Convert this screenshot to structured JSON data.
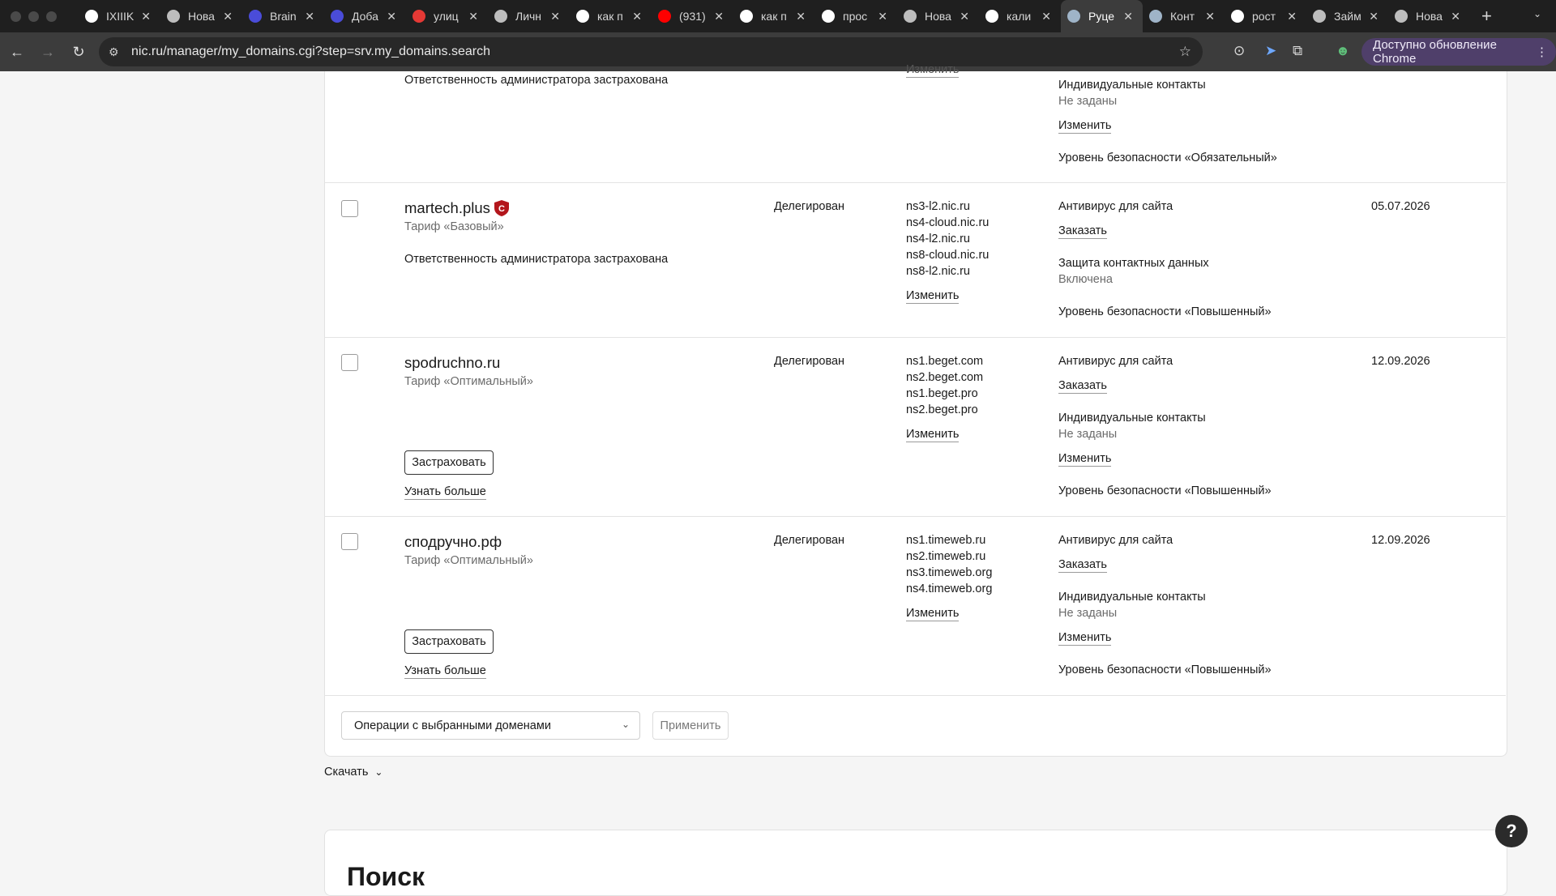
{
  "browser": {
    "tabs": [
      {
        "title": "IXIIIK",
        "icon": "github-icon",
        "color": "#ffffff"
      },
      {
        "title": "Нова",
        "icon": "globe-icon",
        "color": "#bdbdbd"
      },
      {
        "title": "Brain",
        "icon": "brain-app-icon",
        "color": "#4a4cd9"
      },
      {
        "title": "Доба",
        "icon": "brain-app-icon",
        "color": "#4a4cd9"
      },
      {
        "title": "улиц",
        "icon": "maps-pin-icon",
        "color": "#e53935"
      },
      {
        "title": "Личн",
        "icon": "gear-site-icon",
        "color": "#bdbdbd"
      },
      {
        "title": "как п",
        "icon": "google-icon",
        "color": "#ffffff"
      },
      {
        "title": "(931)",
        "icon": "youtube-icon",
        "color": "#ff0000"
      },
      {
        "title": "как п",
        "icon": "google-icon",
        "color": "#ffffff"
      },
      {
        "title": "прос",
        "icon": "google-icon",
        "color": "#ffffff"
      },
      {
        "title": "Нова",
        "icon": "chatgpt-icon",
        "color": "#bdbdbd"
      },
      {
        "title": "кали",
        "icon": "google-icon",
        "color": "#ffffff"
      },
      {
        "title": "Руце",
        "icon": "nic-icon",
        "color": "#9fb4c8"
      },
      {
        "title": "Конт",
        "icon": "nic-icon",
        "color": "#9fb4c8"
      },
      {
        "title": "рост",
        "icon": "google-icon",
        "color": "#ffffff"
      },
      {
        "title": "Займ",
        "icon": "globe-icon",
        "color": "#bdbdbd"
      },
      {
        "title": "Нова",
        "icon": "loading-icon",
        "color": "#bdbdbd"
      }
    ],
    "active_tab_index": 12,
    "url": "nic.ru/manager/my_domains.cgi?step=srv.my_domains.search",
    "update_button": "Доступно обновление Chrome"
  },
  "top_partial": {
    "ns_change": "Изменить",
    "insurance": "Ответственность администратора застрахована",
    "contacts_label": "Индивидуальные контакты",
    "contacts_value": "Не заданы",
    "contacts_change": "Изменить",
    "security": "Уровень безопасности «Обязательный»"
  },
  "domains": [
    {
      "name": "martech.plus",
      "tariff": "Тариф «Базовый»",
      "insurance": "Ответственность администратора застрахована",
      "status": "Делегирован",
      "ns": [
        "ns3-l2.nic.ru",
        "ns4-cloud.nic.ru",
        "ns4-l2.nic.ru",
        "ns8-cloud.nic.ru",
        "ns8-l2.nic.ru"
      ],
      "ns_change": "Изменить",
      "antivirus": "Антивирус для сайта",
      "antivirus_action": "Заказать",
      "contacts_label": "Защита контактных данных",
      "contacts_value": "Включена",
      "security": "Уровень безопасности «Повышенный»",
      "date": "05.07.2026"
    },
    {
      "name": "spodruchno.ru",
      "tariff": "Тариф «Оптимальный»",
      "insure_button": "Застраховать",
      "learn_more": "Узнать больше",
      "status": "Делегирован",
      "ns": [
        "ns1.beget.com",
        "ns2.beget.com",
        "ns1.beget.pro",
        "ns2.beget.pro"
      ],
      "ns_change": "Изменить",
      "antivirus": "Антивирус для сайта",
      "antivirus_action": "Заказать",
      "contacts_label": "Индивидуальные контакты",
      "contacts_value": "Не заданы",
      "contacts_change": "Изменить",
      "security": "Уровень безопасности «Повышенный»",
      "date": "12.09.2026"
    },
    {
      "name": "сподручно.рф",
      "tariff": "Тариф «Оптимальный»",
      "insure_button": "Застраховать",
      "learn_more": "Узнать больше",
      "status": "Делегирован",
      "ns": [
        "ns1.timeweb.ru",
        "ns2.timeweb.ru",
        "ns3.timeweb.org",
        "ns4.timeweb.org"
      ],
      "ns_change": "Изменить",
      "antivirus": "Антивирус для сайта",
      "antivirus_action": "Заказать",
      "contacts_label": "Индивидуальные контакты",
      "contacts_value": "Не заданы",
      "contacts_change": "Изменить",
      "security": "Уровень безопасности «Повышенный»",
      "date": "12.09.2026"
    }
  ],
  "bulk": {
    "select_value": "Операции с выбранными доменами",
    "apply": "Применить"
  },
  "download": "Скачать",
  "next_section_heading": "Поиск",
  "help": "?"
}
